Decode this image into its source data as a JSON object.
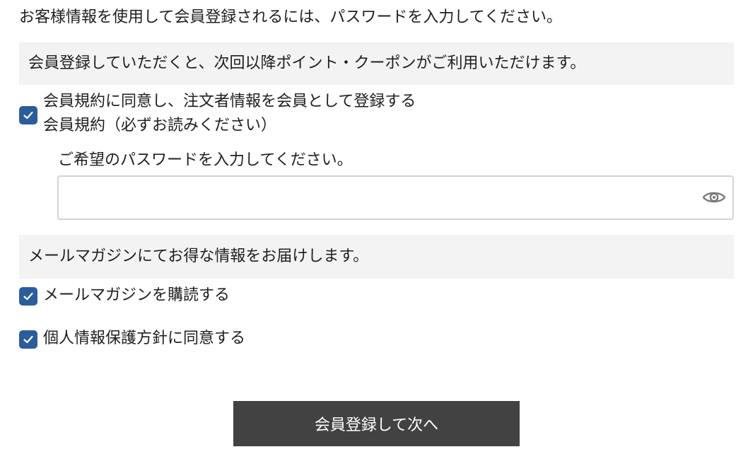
{
  "intro_text": "お客様情報を使用して会員登録されるには、パスワードを入力してください。",
  "member_banner": "会員登録していただくと、次回以降ポイント・クーポンがご利用いただけます。",
  "terms": {
    "checkbox_label": "会員規約に同意し、注文者情報を会員として登録する",
    "link_text": "会員規約（必ずお読みください）",
    "checked": true
  },
  "password": {
    "label": "ご希望のパスワードを入力してください。",
    "value": "",
    "placeholder": "",
    "toggle_icon": "eye-icon"
  },
  "mail_banner": "メールマガジンにてお得な情報をお届けします。",
  "newsletter": {
    "label": "メールマガジンを購読する",
    "checked": true
  },
  "privacy": {
    "label": "個人情報保護方針に同意する",
    "checked": true
  },
  "submit_label": "会員登録して次へ",
  "colors": {
    "checkbox": "#2b5d9c",
    "banner_bg": "#f3f3f3",
    "button_bg": "#424242",
    "button_text": "#ffffff"
  }
}
